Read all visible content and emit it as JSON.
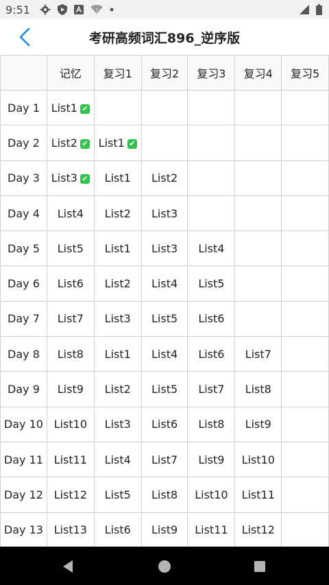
{
  "status": {
    "time": "9:51"
  },
  "header": {
    "title": "考研高频词汇896_逆序版"
  },
  "table": {
    "columns": [
      "",
      "记忆",
      "复习1",
      "复习2",
      "复习3",
      "复习4",
      "复习5"
    ],
    "rows": [
      {
        "day": "Day 1",
        "cells": [
          {
            "t": "List1",
            "c": true
          },
          {
            "t": ""
          },
          {
            "t": ""
          },
          {
            "t": ""
          },
          {
            "t": ""
          },
          {
            "t": ""
          }
        ]
      },
      {
        "day": "Day 2",
        "cells": [
          {
            "t": "List2",
            "c": true
          },
          {
            "t": "List1",
            "c": true
          },
          {
            "t": ""
          },
          {
            "t": ""
          },
          {
            "t": ""
          },
          {
            "t": ""
          }
        ]
      },
      {
        "day": "Day 3",
        "cells": [
          {
            "t": "List3",
            "c": true
          },
          {
            "t": "List1"
          },
          {
            "t": "List2"
          },
          {
            "t": ""
          },
          {
            "t": ""
          },
          {
            "t": ""
          }
        ]
      },
      {
        "day": "Day 4",
        "cells": [
          {
            "t": "List4"
          },
          {
            "t": "List2"
          },
          {
            "t": "List3"
          },
          {
            "t": ""
          },
          {
            "t": ""
          },
          {
            "t": ""
          }
        ]
      },
      {
        "day": "Day 5",
        "cells": [
          {
            "t": "List5"
          },
          {
            "t": "List1"
          },
          {
            "t": "List3"
          },
          {
            "t": "List4"
          },
          {
            "t": ""
          },
          {
            "t": ""
          }
        ]
      },
      {
        "day": "Day 6",
        "cells": [
          {
            "t": "List6"
          },
          {
            "t": "List2"
          },
          {
            "t": "List4"
          },
          {
            "t": "List5"
          },
          {
            "t": ""
          },
          {
            "t": ""
          }
        ]
      },
      {
        "day": "Day 7",
        "cells": [
          {
            "t": "List7"
          },
          {
            "t": "List3"
          },
          {
            "t": "List5"
          },
          {
            "t": "List6"
          },
          {
            "t": ""
          },
          {
            "t": ""
          }
        ]
      },
      {
        "day": "Day 8",
        "cells": [
          {
            "t": "List8"
          },
          {
            "t": "List1"
          },
          {
            "t": "List4"
          },
          {
            "t": "List6"
          },
          {
            "t": "List7"
          },
          {
            "t": ""
          }
        ]
      },
      {
        "day": "Day 9",
        "cells": [
          {
            "t": "List9"
          },
          {
            "t": "List2"
          },
          {
            "t": "List5"
          },
          {
            "t": "List7"
          },
          {
            "t": "List8"
          },
          {
            "t": ""
          }
        ]
      },
      {
        "day": "Day 10",
        "cells": [
          {
            "t": "List10"
          },
          {
            "t": "List3"
          },
          {
            "t": "List6"
          },
          {
            "t": "List8"
          },
          {
            "t": "List9"
          },
          {
            "t": ""
          }
        ]
      },
      {
        "day": "Day 11",
        "cells": [
          {
            "t": "List11"
          },
          {
            "t": "List4"
          },
          {
            "t": "List7"
          },
          {
            "t": "List9"
          },
          {
            "t": "List10"
          },
          {
            "t": ""
          }
        ]
      },
      {
        "day": "Day 12",
        "cells": [
          {
            "t": "List12"
          },
          {
            "t": "List5"
          },
          {
            "t": "List8"
          },
          {
            "t": "List10"
          },
          {
            "t": "List11"
          },
          {
            "t": ""
          }
        ]
      },
      {
        "day": "Day 13",
        "cells": [
          {
            "t": "List13"
          },
          {
            "t": "List6"
          },
          {
            "t": "List9"
          },
          {
            "t": "List11"
          },
          {
            "t": "List12"
          },
          {
            "t": ""
          }
        ]
      }
    ]
  },
  "icons": {
    "back": "chevron-left-icon",
    "check": "check-mark-icon",
    "nav_back": "triangle-back-icon",
    "nav_home": "circle-home-icon",
    "nav_recents": "square-recents-icon"
  },
  "colors": {
    "accent": "#1e88e5",
    "check": "#33c24d",
    "grid_line": "#d0d0d0",
    "nav_bar": "#000000"
  }
}
